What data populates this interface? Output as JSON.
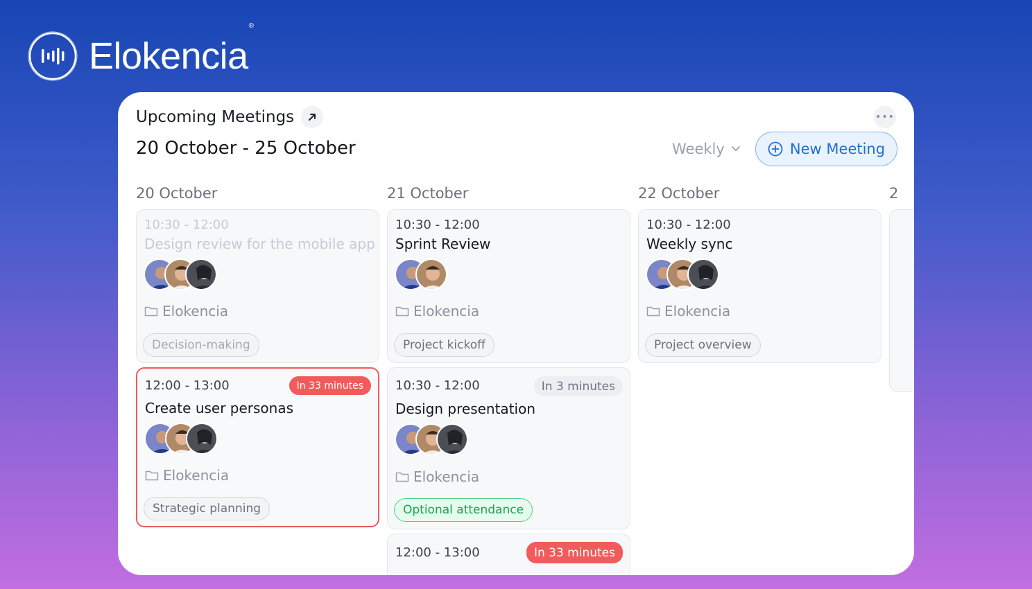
{
  "brand": {
    "name": "Elokencia",
    "registered": "®"
  },
  "panel": {
    "title": "Upcoming Meetings",
    "date_range": "20 October - 25 October",
    "period": "Weekly",
    "new_meeting_label": "New Meeting",
    "more_label": "•••"
  },
  "days": [
    {
      "label": "20 October",
      "meetings": [
        {
          "time": "10:30 - 12:00",
          "title": "Design review for the mobile app",
          "project": "Elokencia",
          "tag": "Decision-making",
          "state": "past"
        },
        {
          "time": "12:00 - 13:00",
          "title": "Create user personas",
          "project": "Elokencia",
          "tag": "Strategic planning",
          "badge": "In 33 minutes"
        }
      ]
    },
    {
      "label": "21 October",
      "meetings": [
        {
          "time": "10:30 - 12:00",
          "title": "Sprint Review",
          "project": "Elokencia",
          "tag": "Project kickoff"
        },
        {
          "time": "10:30 - 12:00",
          "title": "Design presentation",
          "project": "Elokencia",
          "tag": "Optional attendance",
          "badge": "In 3 minutes"
        },
        {
          "time": "12:00 - 13:00",
          "badge": "In 33 minutes"
        }
      ]
    },
    {
      "label": "22 October",
      "meetings": [
        {
          "time": "10:30 - 12:00",
          "title": "Weekly sync",
          "project": "Elokencia",
          "tag": "Project overview"
        }
      ]
    },
    {
      "label": "2"
    }
  ]
}
